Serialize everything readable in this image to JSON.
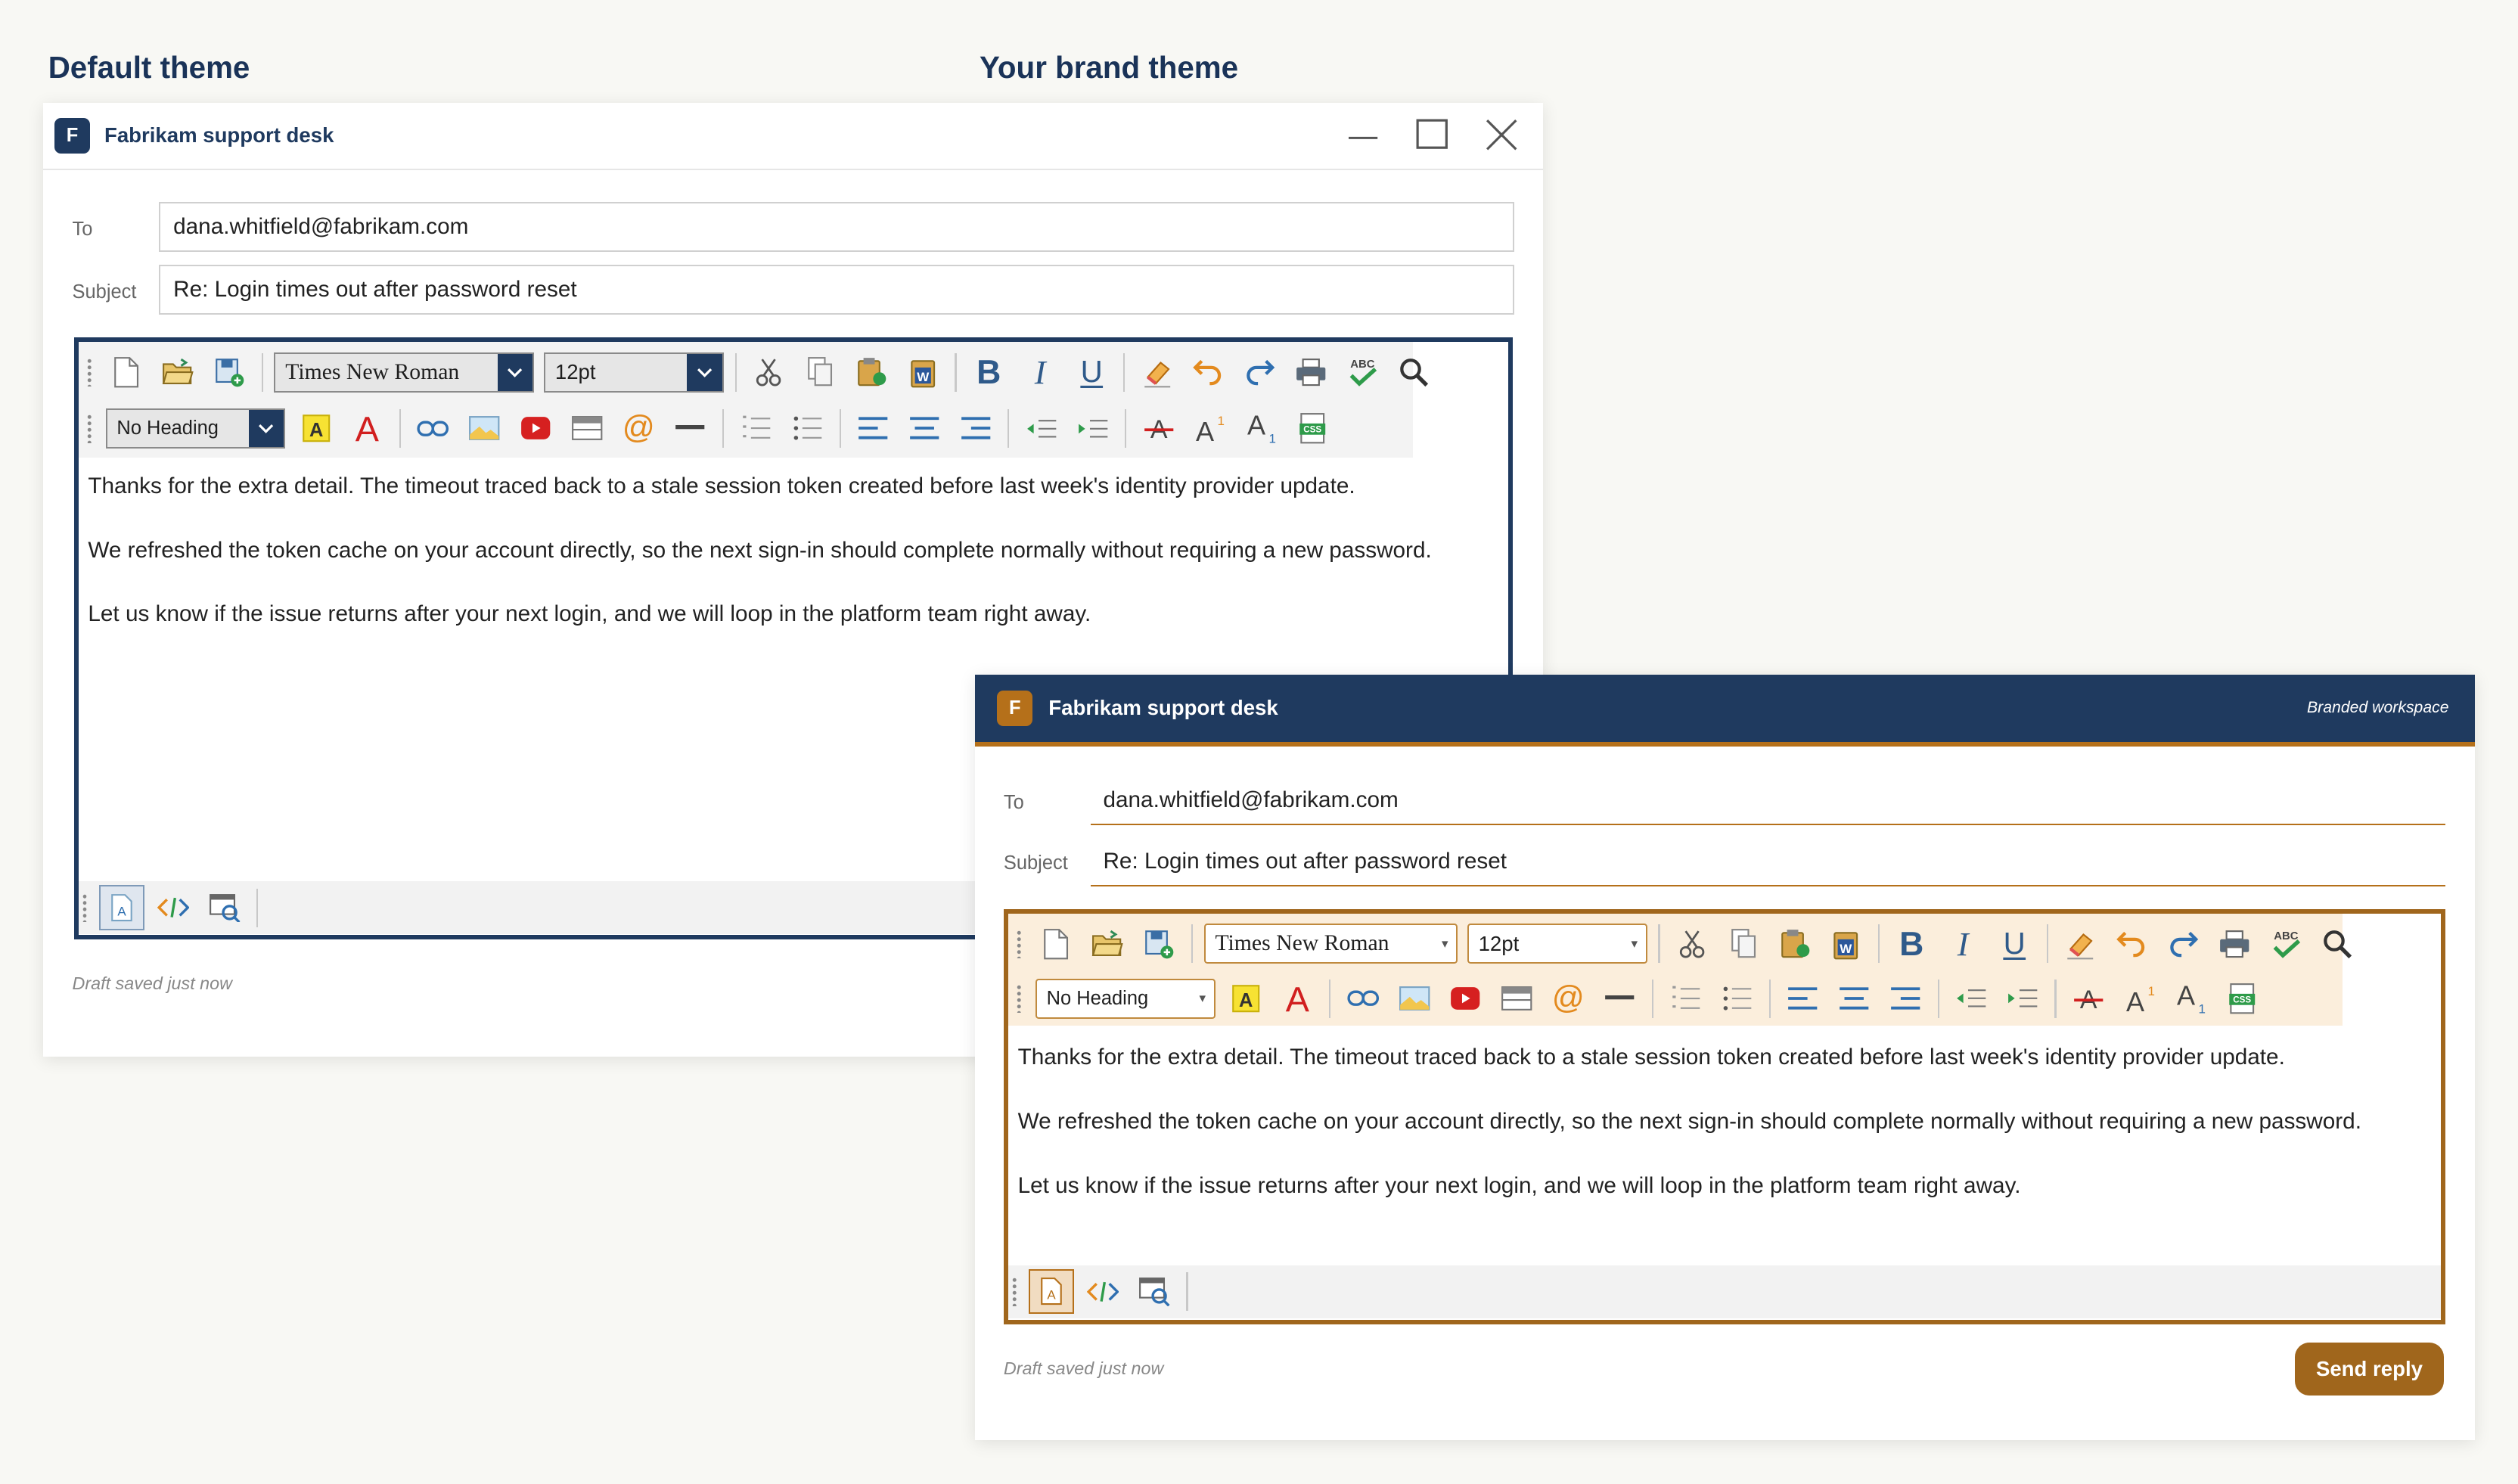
{
  "labels": {
    "default": "Default theme",
    "brand": "Your brand theme"
  },
  "app": {
    "logo_letter": "F",
    "title": "Fabrikam support desk",
    "tagline": "Branded workspace"
  },
  "form": {
    "to_label": "To",
    "to_value": "dana.whitfield@fabrikam.com",
    "subject_label": "Subject",
    "subject_value": "Re: Login times out after password reset"
  },
  "editor": {
    "font": "Times New Roman",
    "size": "12pt",
    "heading": "No Heading",
    "paragraphs": [
      "Thanks for the extra detail. The timeout traced back to a stale session token created before last week's identity provider update.",
      "We refreshed the token cache on your account directly, so the next sign-in should complete normally without requiring a new password.",
      "Let us know if the issue returns after your next login, and we will loop in the platform team right away."
    ],
    "toolbar1_icons": [
      "new-document-icon",
      "open-folder-icon",
      "save-icon",
      "cut-icon",
      "copy-icon",
      "paste-icon",
      "paste-from-word-icon",
      "bold-icon",
      "italic-icon",
      "underline-icon",
      "clear-formatting-icon",
      "undo-icon",
      "redo-icon",
      "print-icon",
      "spellcheck-icon",
      "find-icon"
    ],
    "toolbar2_icons": [
      "highlight-color-icon",
      "font-color-icon",
      "link-icon",
      "image-icon",
      "video-icon",
      "table-icon",
      "email-link-icon",
      "horizontal-rule-icon",
      "numbered-list-icon",
      "bulleted-list-icon",
      "align-left-icon",
      "align-center-icon",
      "align-right-icon",
      "outdent-icon",
      "indent-icon",
      "strikethrough-icon",
      "superscript-icon",
      "subscript-icon",
      "css-class-icon"
    ],
    "mode_icons": [
      "design-mode-icon",
      "html-mode-icon",
      "preview-mode-icon"
    ]
  },
  "status": {
    "draft": "Draft saved just now"
  },
  "actions": {
    "send": "Send reply"
  },
  "colors": {
    "navy": "#1f3a5f",
    "brand_accent": "#b5701a",
    "brand_toolbar_bg": "#fbeedc",
    "background": "#f8f8f4"
  }
}
